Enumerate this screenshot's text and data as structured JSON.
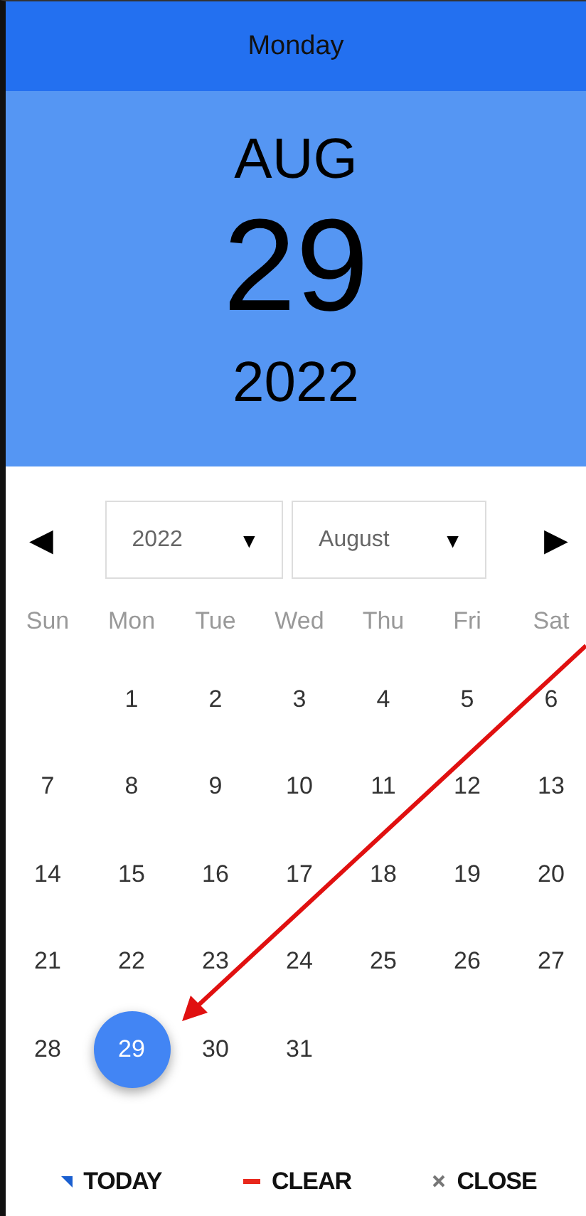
{
  "weekday_bar": {
    "title": "Monday"
  },
  "date_display": {
    "month": "AUG",
    "day": "29",
    "year": "2022"
  },
  "navigation": {
    "prev": "◀",
    "next": "▶",
    "year_select": {
      "value": "2022",
      "caret": "▼"
    },
    "month_select": {
      "value": "August",
      "caret": "▼"
    }
  },
  "weekdays": [
    "Sun",
    "Mon",
    "Tue",
    "Wed",
    "Thu",
    "Fri",
    "Sat"
  ],
  "weeks": [
    [
      {
        "label": "1",
        "selected": false
      },
      {
        "label": "2",
        "selected": false
      },
      {
        "label": "3",
        "selected": false
      },
      {
        "label": "4",
        "selected": false
      },
      {
        "label": "5",
        "selected": false
      },
      {
        "label": "6",
        "selected": false
      }
    ],
    [
      {
        "label": "7",
        "selected": false
      },
      {
        "label": "8",
        "selected": false
      },
      {
        "label": "9",
        "selected": false
      },
      {
        "label": "10",
        "selected": false
      },
      {
        "label": "11",
        "selected": false
      },
      {
        "label": "12",
        "selected": false
      },
      {
        "label": "13",
        "selected": false
      }
    ],
    [
      {
        "label": "14",
        "selected": false
      },
      {
        "label": "15",
        "selected": false
      },
      {
        "label": "16",
        "selected": false
      },
      {
        "label": "17",
        "selected": false
      },
      {
        "label": "18",
        "selected": false
      },
      {
        "label": "19",
        "selected": false
      },
      {
        "label": "20",
        "selected": false
      }
    ],
    [
      {
        "label": "21",
        "selected": false
      },
      {
        "label": "22",
        "selected": false
      },
      {
        "label": "23",
        "selected": false
      },
      {
        "label": "24",
        "selected": false
      },
      {
        "label": "25",
        "selected": false
      },
      {
        "label": "26",
        "selected": false
      },
      {
        "label": "27",
        "selected": false
      }
    ],
    [
      {
        "label": "28",
        "selected": false
      },
      {
        "label": "29",
        "selected": true
      },
      {
        "label": "30",
        "selected": false
      },
      {
        "label": "31",
        "selected": false
      }
    ]
  ],
  "actions": [
    {
      "kind": "today",
      "label": "TODAY"
    },
    {
      "kind": "clear",
      "label": "CLEAR"
    },
    {
      "kind": "close",
      "label": "CLOSE"
    }
  ],
  "annotation": {
    "kind": "arrow"
  }
}
